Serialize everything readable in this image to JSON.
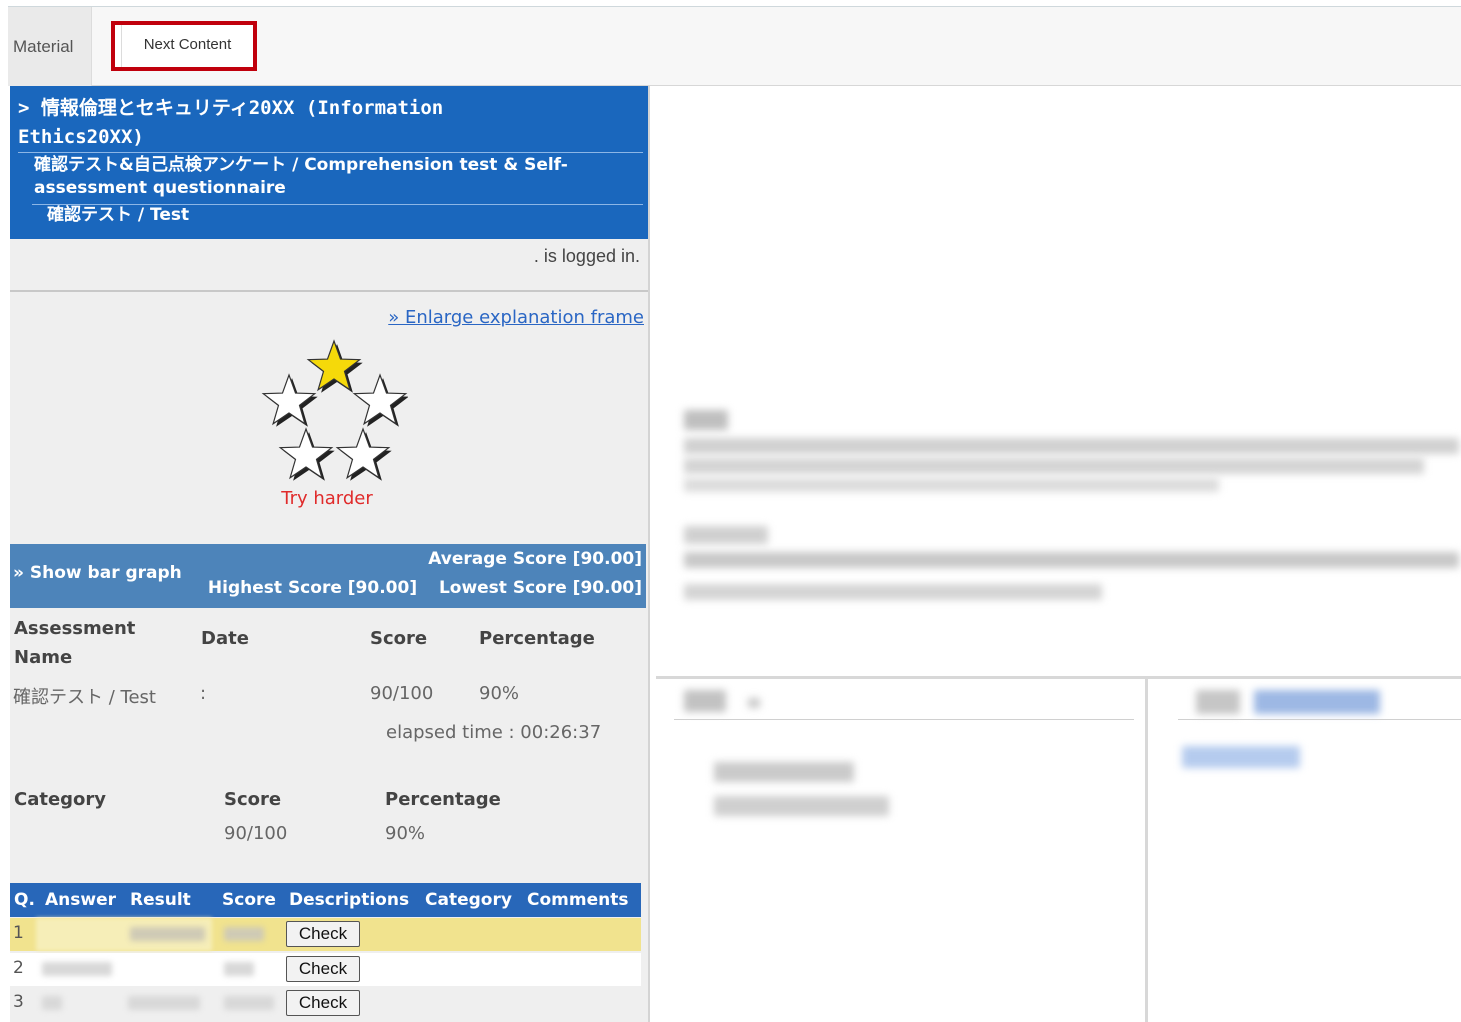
{
  "tabs": {
    "material": "Material",
    "next_content": "Next Content"
  },
  "breadcrumb": {
    "course": "> 情報倫理とセキュリティ20XX (Information Ethics20XX)",
    "unit": "確認テスト&自己点検アンケート / Comprehension test & Self-assessment questionnaire",
    "item": "確認テスト / Test"
  },
  "login_status": ". is logged in.",
  "enlarge_link": "» Enlarge explanation frame",
  "rating": {
    "stars_total": 5,
    "stars_filled": 1,
    "message": "Try harder",
    "filled_color": "#f5d90a",
    "message_color": "#e02b2b"
  },
  "score_bar": {
    "show_bar_graph": "» Show bar graph",
    "average": "Average Score [90.00]",
    "highest": "Highest Score [90.00]",
    "lowest": "Lowest Score [90.00]"
  },
  "result_table": {
    "headers": [
      "Assessment Name",
      "Date",
      "Score",
      "Percentage"
    ],
    "row": {
      "name": "確認テスト / Test",
      "date": ":",
      "score": "90/100",
      "percentage": "90%"
    },
    "elapsed": "elapsed time : 00:26:37"
  },
  "category_table": {
    "headers": [
      "Category",
      "Score",
      "Percentage"
    ],
    "row": {
      "score": "90/100",
      "percentage": "90%"
    }
  },
  "question_table": {
    "headers": [
      "Q.",
      "Answer",
      "Result",
      "Score",
      "Descriptions",
      "Category",
      "Comments"
    ],
    "rows": [
      {
        "num": "1",
        "button": "Check",
        "highlight": true
      },
      {
        "num": "2",
        "button": "Check",
        "highlight": false
      },
      {
        "num": "3",
        "button": "Check",
        "highlight": false
      }
    ]
  },
  "colors": {
    "breadcrumb_bg": "#1a67bd",
    "score_bar_bg": "#4d84ba",
    "table_head_bg": "#2867b9",
    "highlight_row": "#f1e38e",
    "next_tab_border": "#c0000c",
    "link": "#2a66c4"
  }
}
